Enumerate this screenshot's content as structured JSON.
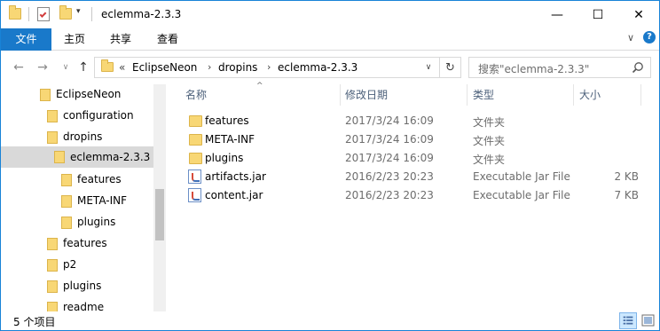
{
  "window": {
    "title": "eclemma-2.3.3",
    "minimize": "—",
    "maximize": "☐",
    "close": "✕"
  },
  "ribbon": {
    "tabs": [
      "文件",
      "主页",
      "共享",
      "查看"
    ],
    "collapse": "∨",
    "help": "?"
  },
  "nav": {
    "back": "←",
    "forward": "→",
    "recent": "∨",
    "up": "↑",
    "overflow": "«",
    "breadcrumb": [
      "EclipseNeon",
      "dropins",
      "eclemma-2.3.3"
    ],
    "crumb_sep": "›",
    "dropdown": "∨",
    "refresh": "↻",
    "search_placeholder": "搜索\"eclemma-2.3.3\""
  },
  "tree": {
    "items": [
      {
        "label": "EclipseNeon",
        "level": 0,
        "selected": false
      },
      {
        "label": "configuration",
        "level": 1,
        "selected": false
      },
      {
        "label": "dropins",
        "level": 1,
        "selected": false
      },
      {
        "label": "eclemma-2.3.3",
        "level": 2,
        "selected": true
      },
      {
        "label": "features",
        "level": 3,
        "selected": false
      },
      {
        "label": "META-INF",
        "level": 3,
        "selected": false
      },
      {
        "label": "plugins",
        "level": 3,
        "selected": false
      },
      {
        "label": "features",
        "level": 1,
        "selected": false
      },
      {
        "label": "p2",
        "level": 1,
        "selected": false
      },
      {
        "label": "plugins",
        "level": 1,
        "selected": false
      },
      {
        "label": "readme",
        "level": 1,
        "selected": false
      }
    ]
  },
  "columns": {
    "name": "名称",
    "date": "修改日期",
    "type": "类型",
    "size": "大小",
    "sort_indicator": "^"
  },
  "files": [
    {
      "name": "features",
      "date": "2017/3/24 16:09",
      "type": "文件夹",
      "size": "",
      "icon": "folder-icon"
    },
    {
      "name": "META-INF",
      "date": "2017/3/24 16:09",
      "type": "文件夹",
      "size": "",
      "icon": "folder-icon"
    },
    {
      "name": "plugins",
      "date": "2017/3/24 16:09",
      "type": "文件夹",
      "size": "",
      "icon": "folder-icon"
    },
    {
      "name": "artifacts.jar",
      "date": "2016/2/23 20:23",
      "type": "Executable Jar File",
      "size": "2 KB",
      "icon": "jar-file-icon"
    },
    {
      "name": "content.jar",
      "date": "2016/2/23 20:23",
      "type": "Executable Jar File",
      "size": "7 KB",
      "icon": "jar-file-icon"
    }
  ],
  "status": {
    "item_count": "5 个项目"
  },
  "colors": {
    "accent": "#1979ca",
    "selection": "#cce8ff",
    "folder": "#f8d775"
  }
}
